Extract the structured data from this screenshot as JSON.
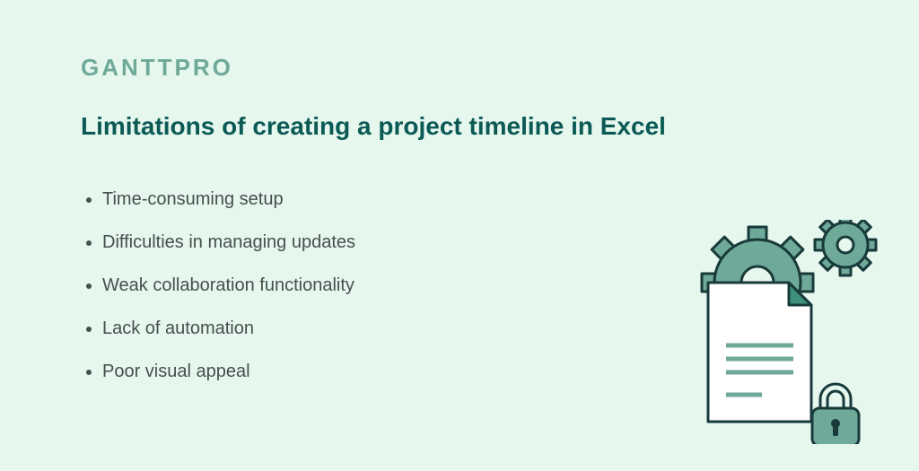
{
  "brand": {
    "name": "GANTTPRO"
  },
  "heading": "Limitations of creating a project timeline in Excel",
  "bullets": [
    "Time-consuming setup",
    "Difficulties in managing updates",
    "Weak collaboration functionality",
    "Lack of automation",
    "Poor visual appeal"
  ],
  "colors": {
    "background": "#e6f7ee",
    "accent_dark": "#0b5a55",
    "accent_mid": "#6fa99a",
    "text": "#44504f",
    "stroke": "#183a3a"
  }
}
